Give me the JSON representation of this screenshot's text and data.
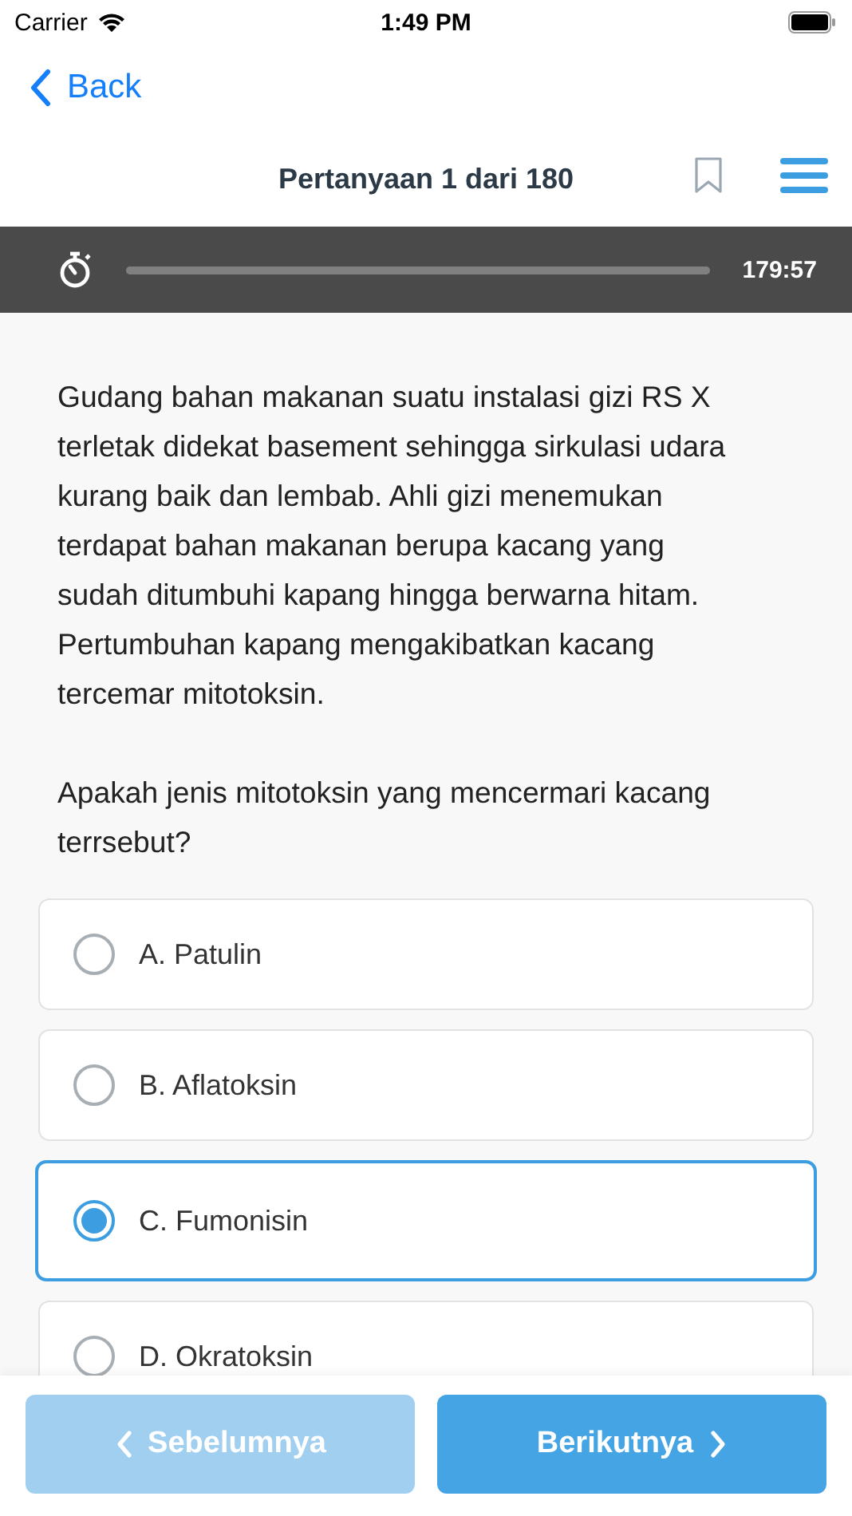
{
  "status_bar": {
    "carrier": "Carrier",
    "time": "1:49 PM"
  },
  "nav": {
    "back": "Back"
  },
  "header": {
    "title": "Pertanyaan 1 dari 180",
    "bookmarked": false
  },
  "timer": {
    "level": 1,
    "remaining": "179:57"
  },
  "question": {
    "paragraphs": [
      "Gudang bahan makanan suatu instalasi gizi RS X terletak didekat basement sehingga sirkulasi udara kurang baik dan lembab. Ahli gizi menemukan terdapat bahan makanan berupa kacang yang sudah ditumbuhi kapang hingga berwarna hitam. Pertumbuhan kapang mengakibatkan kacang tercemar mitotoksin.",
      "Apakah jenis mitotoksin yang mencermari kacang terrsebut?"
    ]
  },
  "options": [
    {
      "label": "A. Patulin",
      "selected": false
    },
    {
      "label": "B. Aflatoksin",
      "selected": false
    },
    {
      "label": "C. Fumonisin",
      "selected": true
    },
    {
      "label": "D. Okratoksin",
      "selected": false
    }
  ],
  "footer": {
    "previous": {
      "label": "Sebelumnya",
      "disabled": true
    },
    "next": {
      "label": "Berikutnya",
      "disabled": false
    }
  }
}
